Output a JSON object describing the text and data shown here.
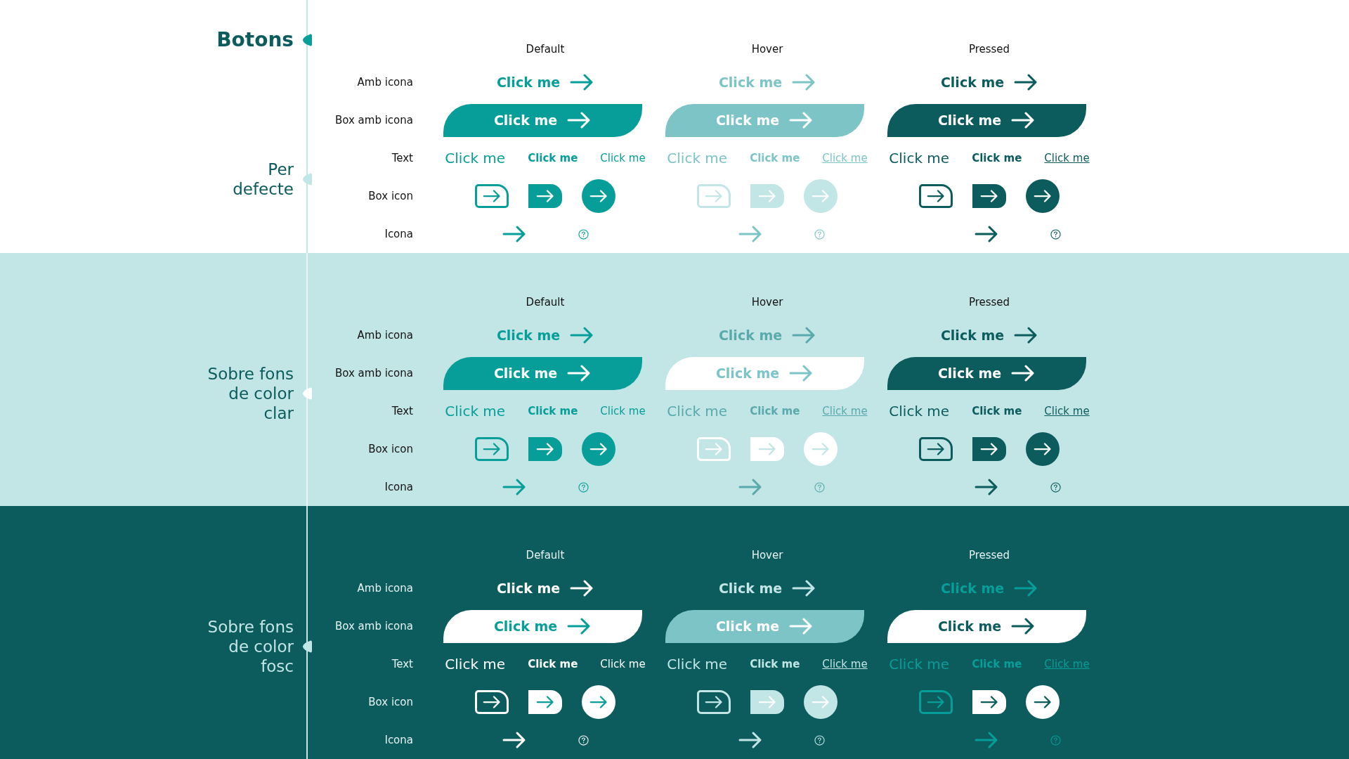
{
  "title": "Botons",
  "sections": [
    {
      "label": "Per defecte",
      "kind": "white",
      "columns": [
        {
          "label": "Default",
          "kind": "default"
        },
        {
          "label": "Hover",
          "kind": "hover"
        },
        {
          "label": "Pressed",
          "kind": "pressed"
        }
      ],
      "rows": [
        {
          "label": "Amb icona",
          "kind": "link_arrow",
          "cells": [
            "Click me",
            "Click me",
            "Click me"
          ]
        },
        {
          "label": "Box amb icona",
          "kind": "box_arrow",
          "cells": [
            "Click me",
            "Click me",
            "Click me"
          ]
        },
        {
          "label": "Text",
          "kind": "text_links",
          "cells": [
            [
              {
                "text": "Click me",
                "underlined": false
              },
              {
                "text": "Click me",
                "underlined": false
              },
              {
                "text": "Click me",
                "underlined": false
              }
            ],
            [
              {
                "text": "Click me",
                "underlined": false
              },
              {
                "text": "Click me",
                "underlined": false
              },
              {
                "text": "Click me",
                "underlined": true
              }
            ],
            [
              {
                "text": "Click me",
                "underlined": false
              },
              {
                "text": "Click me",
                "underlined": false
              },
              {
                "text": "Click me",
                "underlined": true
              }
            ]
          ]
        },
        {
          "label": "Box icon",
          "kind": "icon_boxes"
        },
        {
          "label": "Icona",
          "kind": "icons"
        }
      ]
    },
    {
      "label": "Sobre fons de color clar",
      "kind": "light",
      "columns": [
        {
          "label": "Default",
          "kind": "default"
        },
        {
          "label": "Hover",
          "kind": "hover"
        },
        {
          "label": "Pressed",
          "kind": "pressed"
        }
      ],
      "rows": [
        {
          "label": "Amb icona",
          "kind": "link_arrow",
          "cells": [
            "Click me",
            "Click me",
            "Click me"
          ]
        },
        {
          "label": "Box amb icona",
          "kind": "box_arrow",
          "cells": [
            "Click me",
            "Click me",
            "Click me"
          ]
        },
        {
          "label": "Text",
          "kind": "text_links",
          "cells": [
            [
              {
                "text": "Click me",
                "underlined": false
              },
              {
                "text": "Click me",
                "underlined": false
              },
              {
                "text": "Click me",
                "underlined": false
              }
            ],
            [
              {
                "text": "Click me",
                "underlined": false
              },
              {
                "text": "Click me",
                "underlined": false
              },
              {
                "text": "Click me",
                "underlined": true
              }
            ],
            [
              {
                "text": "Click me",
                "underlined": false
              },
              {
                "text": "Click me",
                "underlined": false
              },
              {
                "text": "Click me",
                "underlined": true
              }
            ]
          ]
        },
        {
          "label": "Box icon",
          "kind": "icon_boxes"
        },
        {
          "label": "Icona",
          "kind": "icons"
        }
      ]
    },
    {
      "label": "Sobre fons de color fosc",
      "kind": "dark",
      "columns": [
        {
          "label": "Default",
          "kind": "default"
        },
        {
          "label": "Hover",
          "kind": "hover"
        },
        {
          "label": "Pressed",
          "kind": "pressed"
        }
      ],
      "rows": [
        {
          "label": "Amb icona",
          "kind": "link_arrow",
          "cells": [
            "Click me",
            "Click me",
            "Click me"
          ]
        },
        {
          "label": "Box amb icona",
          "kind": "box_arrow",
          "cells": [
            "Click me",
            "Click me",
            "Click me"
          ]
        },
        {
          "label": "Text",
          "kind": "text_links",
          "cells": [
            [
              {
                "text": "Click me",
                "underlined": false
              },
              {
                "text": "Click me",
                "underlined": false
              },
              {
                "text": "Click me",
                "underlined": false
              }
            ],
            [
              {
                "text": "Click me",
                "underlined": false
              },
              {
                "text": "Click me",
                "underlined": false
              },
              {
                "text": "Click me",
                "underlined": true
              }
            ],
            [
              {
                "text": "Click me",
                "underlined": false
              },
              {
                "text": "Click me",
                "underlined": false
              },
              {
                "text": "Click me",
                "underlined": true
              }
            ]
          ]
        },
        {
          "label": "Box icon",
          "kind": "icon_boxes"
        },
        {
          "label": "Icona",
          "kind": "icons"
        }
      ]
    }
  ]
}
